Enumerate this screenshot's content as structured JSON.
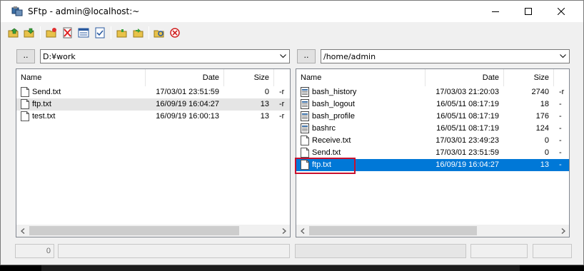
{
  "window": {
    "title": "SFtp - admin@localhost:~"
  },
  "toolbar": {
    "icons": [
      "upload-icon",
      "download-icon",
      "new-folder-icon",
      "delete-icon",
      "rename-icon",
      "properties-icon",
      "move-left-icon",
      "move-right-icon",
      "refresh-icon",
      "stop-icon"
    ]
  },
  "local": {
    "up_label": "..",
    "path": "D:¥work",
    "columns": [
      "Name",
      "Date",
      "Size"
    ],
    "files": [
      {
        "name": "Send.txt",
        "date": "17/03/01 23:51:59",
        "size": "0",
        "tail": "-r",
        "icon": "text-file-icon"
      },
      {
        "name": "ftp.txt",
        "date": "16/09/19 16:04:27",
        "size": "13",
        "tail": "-r",
        "icon": "text-file-icon"
      },
      {
        "name": "test.txt",
        "date": "16/09/19 16:00:13",
        "size": "13",
        "tail": "-r",
        "icon": "text-file-icon"
      }
    ],
    "status_value": "0"
  },
  "remote": {
    "up_label": "..",
    "path": "/home/admin",
    "columns": [
      "Name",
      "Date",
      "Size"
    ],
    "files": [
      {
        "name": "bash_history",
        "date": "17/03/03 21:20:03",
        "size": "2740",
        "tail": "-r",
        "icon": "binary-file-icon"
      },
      {
        "name": "bash_logout",
        "date": "16/05/11 08:17:19",
        "size": "18",
        "tail": "-",
        "icon": "binary-file-icon"
      },
      {
        "name": "bash_profile",
        "date": "16/05/11 08:17:19",
        "size": "176",
        "tail": "-",
        "icon": "binary-file-icon"
      },
      {
        "name": "bashrc",
        "date": "16/05/11 08:17:19",
        "size": "124",
        "tail": "-",
        "icon": "binary-file-icon"
      },
      {
        "name": "Receive.txt",
        "date": "17/03/01 23:49:23",
        "size": "0",
        "tail": "-",
        "icon": "text-file-icon"
      },
      {
        "name": "Send.txt",
        "date": "17/03/01 23:51:59",
        "size": "0",
        "tail": "-",
        "icon": "text-file-icon"
      },
      {
        "name": "ftp.txt",
        "date": "16/09/19 16:04:27",
        "size": "13",
        "tail": "-",
        "icon": "text-file-icon"
      }
    ]
  },
  "colors": {
    "selection": "#0078d7",
    "highlight_box": "#c8102e"
  }
}
